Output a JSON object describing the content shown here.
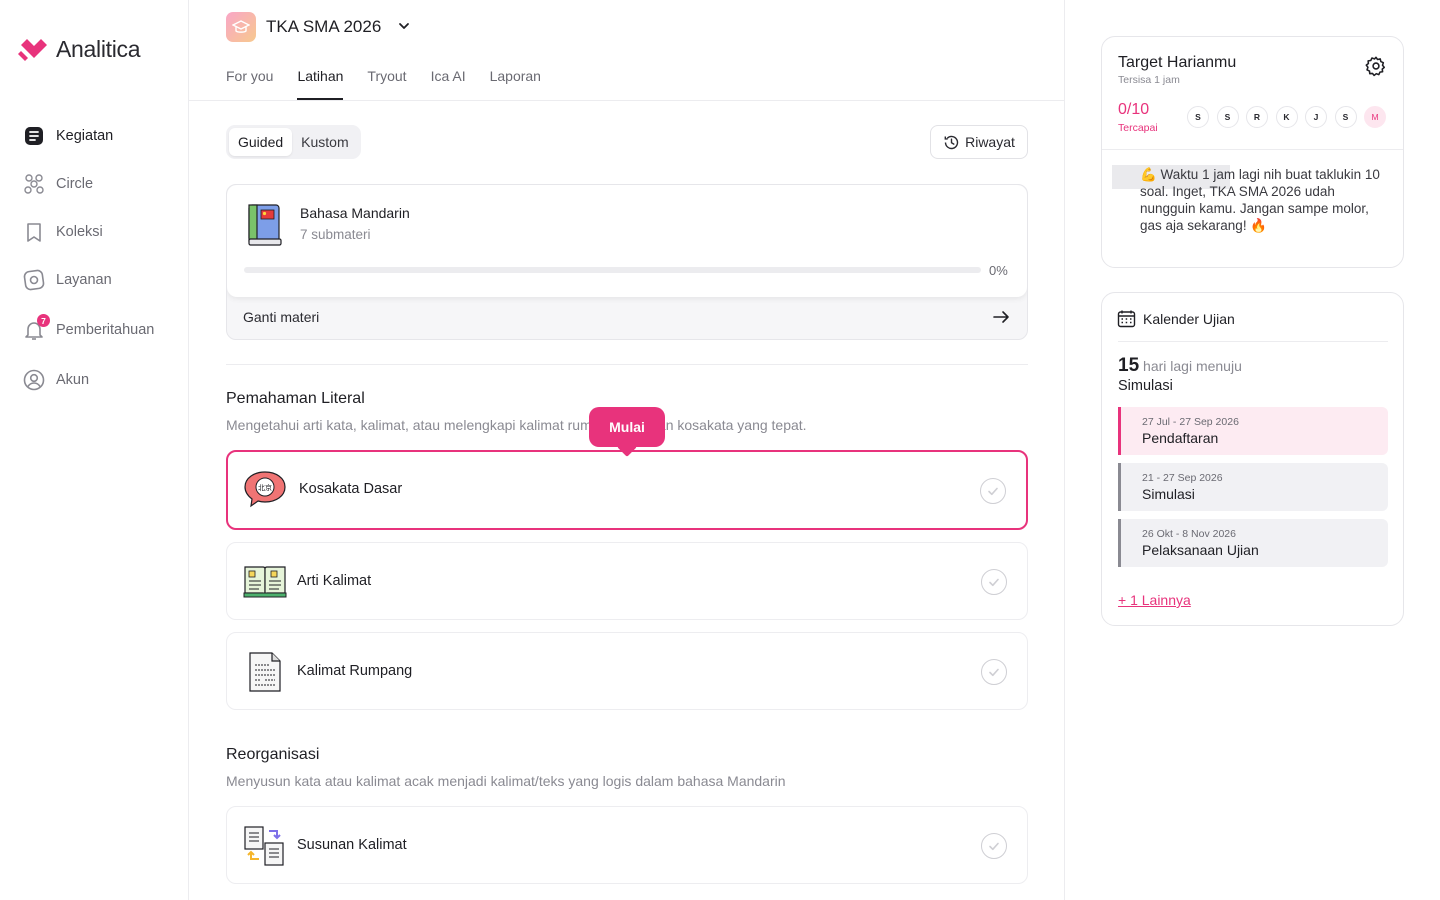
{
  "brand": {
    "name": "Analitica",
    "accent": "#e8337c"
  },
  "sidebar": {
    "items": [
      {
        "label": "Kegiatan",
        "icon": "activity-icon"
      },
      {
        "label": "Circle",
        "icon": "circle-group-icon"
      },
      {
        "label": "Koleksi",
        "icon": "bookmark-icon"
      },
      {
        "label": "Layanan",
        "icon": "service-icon"
      },
      {
        "label": "Pemberitahuan",
        "icon": "bell-icon",
        "badge": "7"
      },
      {
        "label": "Akun",
        "icon": "user-icon"
      }
    ]
  },
  "header": {
    "exam_title": "TKA SMA 2026",
    "tabs": [
      "For you",
      "Latihan",
      "Tryout",
      "Ica AI",
      "Laporan"
    ],
    "active_tab": "Latihan"
  },
  "mode": {
    "guided": "Guided",
    "kustom": "Kustom",
    "active": "Guided"
  },
  "riwayat_label": "Riwayat",
  "subject": {
    "name": "Bahasa Mandarin",
    "sub": "7 submateri",
    "progress": 0,
    "progress_text": "0%",
    "change_label": "Ganti materi"
  },
  "sections": [
    {
      "title": "Pemahaman Literal",
      "desc": "Mengetahui arti kata, kalimat, atau melengkapi kalimat rumpang dengan kosakata yang tepat.",
      "topics": [
        "Kosakata Dasar",
        "Arti Kalimat",
        "Kalimat Rumpang"
      ]
    },
    {
      "title": "Reorganisasi",
      "desc": "Menyusun kata atau kalimat acak menjadi kalimat/teks yang logis dalam bahasa Mandarin",
      "topics": [
        "Susunan Kalimat"
      ]
    }
  ],
  "tooltip": {
    "label": "Mulai"
  },
  "target": {
    "title": "Target Harianmu",
    "remaining": "Tersisa 1 jam",
    "count": "0/10",
    "count_label": "Tercapai",
    "days": [
      "S",
      "S",
      "R",
      "K",
      "J",
      "S",
      "M"
    ],
    "message": "💪 Waktu 1 jam lagi nih buat taklukin 10 soal. Inget, TKA SMA 2026 udah nungguin kamu. Jangan sampe molor, gas aja sekarang! 🔥"
  },
  "calendar": {
    "title": "Kalender Ujian",
    "days_left": "15",
    "days_text": "hari lagi menuju",
    "target": "Simulasi",
    "events": [
      {
        "date": "27 Jul - 27 Sep 2026",
        "name": "Pendaftaran"
      },
      {
        "date": "21 - 27 Sep 2026",
        "name": "Simulasi"
      },
      {
        "date": "26 Okt - 8 Nov 2026",
        "name": "Pelaksanaan Ujian"
      }
    ],
    "more": "+ 1 Lainnya"
  }
}
